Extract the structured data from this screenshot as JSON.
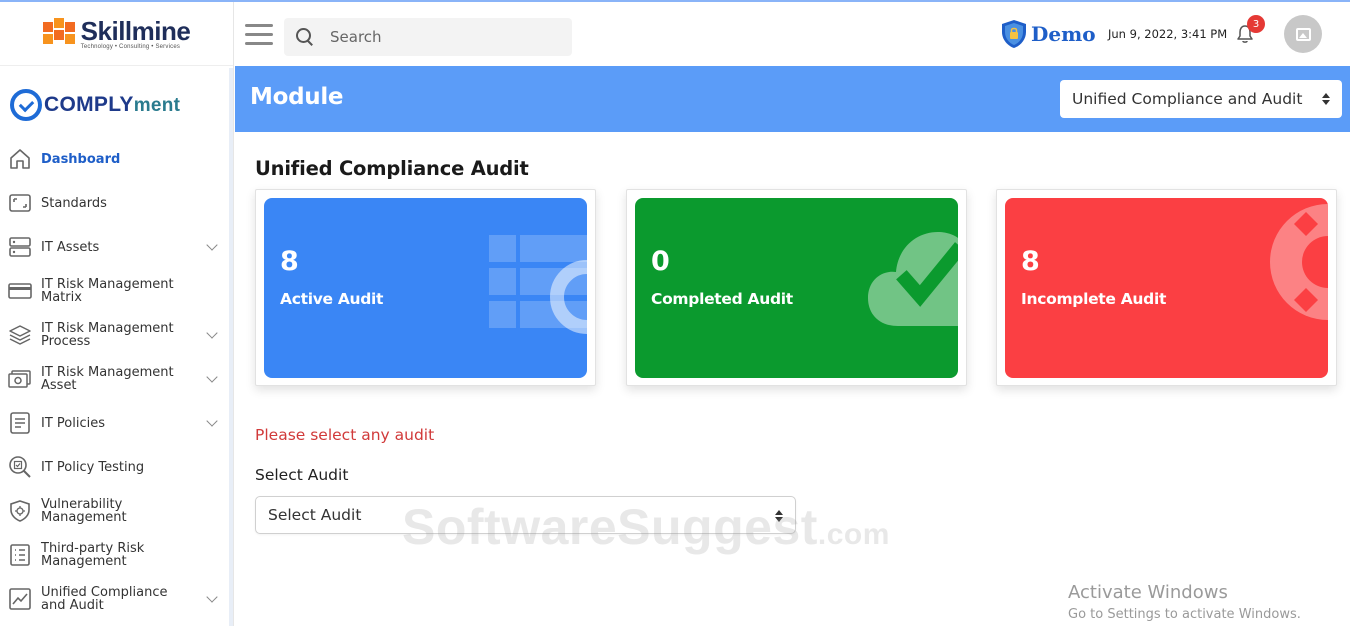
{
  "company": {
    "name": "Skillmine",
    "tagline": "Technology • Consulting • Services",
    "brand_color": "#f26b21"
  },
  "product": {
    "name_main": "COMPLY",
    "name_suffix": "ment"
  },
  "sidebar": {
    "items": [
      {
        "label": "Dashboard",
        "icon": "home-icon",
        "active": true,
        "has_submenu": false
      },
      {
        "label": "Standards",
        "icon": "frame-icon",
        "active": false,
        "has_submenu": false
      },
      {
        "label": "IT Assets",
        "icon": "server-icon",
        "active": false,
        "has_submenu": true
      },
      {
        "label": "IT Risk Management Matrix",
        "icon": "card-icon",
        "active": false,
        "has_submenu": false
      },
      {
        "label": "IT Risk Management Process",
        "icon": "layers-icon",
        "active": false,
        "has_submenu": true
      },
      {
        "label": "IT Risk Management Asset",
        "icon": "money-icon",
        "active": false,
        "has_submenu": true
      },
      {
        "label": "IT Policies",
        "icon": "document-icon",
        "active": false,
        "has_submenu": true
      },
      {
        "label": "IT Policy Testing",
        "icon": "magnifier-check-icon",
        "active": false,
        "has_submenu": false
      },
      {
        "label": "Vulnerability Management",
        "icon": "shield-bug-icon",
        "active": false,
        "has_submenu": false
      },
      {
        "label": "Third-party Risk Management",
        "icon": "list-icon",
        "active": false,
        "has_submenu": false
      },
      {
        "label": "Unified Compliance and Audit",
        "icon": "trend-chart-icon",
        "active": false,
        "has_submenu": true
      }
    ]
  },
  "header": {
    "search_placeholder": "Search",
    "org_label": "Demo",
    "datetime": "Jun 9, 2022, 3:41 PM",
    "notification_count": "3"
  },
  "banner": {
    "title": "Module",
    "module_selected": "Unified Compliance and Audit"
  },
  "main": {
    "section_title": "Unified Compliance Audit",
    "cards": [
      {
        "count": "8",
        "label": "Active Audit",
        "color": "#3a86f5"
      },
      {
        "count": "0",
        "label": "Completed Audit",
        "color": "#0b9a2e"
      },
      {
        "count": "8",
        "label": "Incomplete Audit",
        "color": "#fb3f43"
      }
    ],
    "error_message": "Please select any audit",
    "select_label": "Select Audit",
    "select_value": "Select Audit"
  },
  "overlays": {
    "watermark_main": "SoftwareSuggest",
    "watermark_domain": ".com",
    "activate_title": "Activate Windows",
    "activate_sub": "Go to Settings to activate Windows."
  }
}
